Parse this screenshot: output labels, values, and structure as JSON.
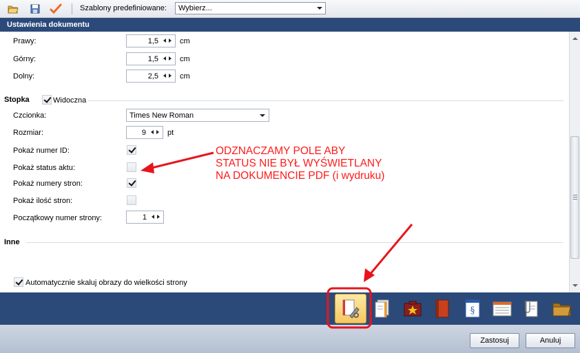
{
  "toolbar": {
    "template_label": "Szablony predefiniowane:",
    "template_value": "Wybierz..."
  },
  "section_title": "Ustawienia dokumentu",
  "margins": {
    "right": {
      "label": "Prawy:",
      "value": "1,5",
      "unit": "cm"
    },
    "top": {
      "label": "Górny:",
      "value": "1,5",
      "unit": "cm"
    },
    "bottom": {
      "label": "Dolny:",
      "value": "2,5",
      "unit": "cm"
    }
  },
  "footer": {
    "title": "Stopka",
    "visible_label": "Widoczna",
    "visible_checked": true,
    "font_label": "Czcionka:",
    "font_value": "Times New Roman",
    "size_label": "Rozmiar:",
    "size_value": "9",
    "size_unit": "pt",
    "show_id_label": "Pokaż numer ID:",
    "show_id_checked": true,
    "show_status_label": "Pokaż status aktu:",
    "show_status_checked": false,
    "show_page_numbers_label": "Pokaż numery stron:",
    "show_page_numbers_checked": true,
    "show_page_count_label": "Pokaż ilość stron:",
    "show_page_count_checked": false,
    "start_page_label": "Początkowy numer strony:",
    "start_page_value": "1"
  },
  "other": {
    "title": "Inne",
    "auto_scale_label": "Automatycznie skaluj obrazy do wielkości strony",
    "auto_scale_checked": true
  },
  "annotation": {
    "line1": "ODZNACZAMY POLE ABY",
    "line2": "STATUS NIE BYŁ WYŚWIETLANY",
    "line3": "NA DOKUMENCIE PDF (i wydruku)",
    "color": "#ff1a1a"
  },
  "icon_bar": [
    {
      "icon": "document-settings-icon",
      "selected": true
    },
    {
      "icon": "documents-stack-icon",
      "selected": false
    },
    {
      "icon": "star-folder-icon",
      "selected": false
    },
    {
      "icon": "book-icon",
      "selected": false
    },
    {
      "icon": "paragraph-law-icon",
      "selected": false
    },
    {
      "icon": "form-list-icon",
      "selected": false
    },
    {
      "icon": "attachment-document-icon",
      "selected": false
    },
    {
      "icon": "folder-icon",
      "selected": false
    }
  ],
  "buttons": {
    "apply": "Zastosuj",
    "cancel": "Anuluj"
  },
  "colors": {
    "header_bg": "#2b4a7a",
    "accent_red": "#e8141b"
  }
}
